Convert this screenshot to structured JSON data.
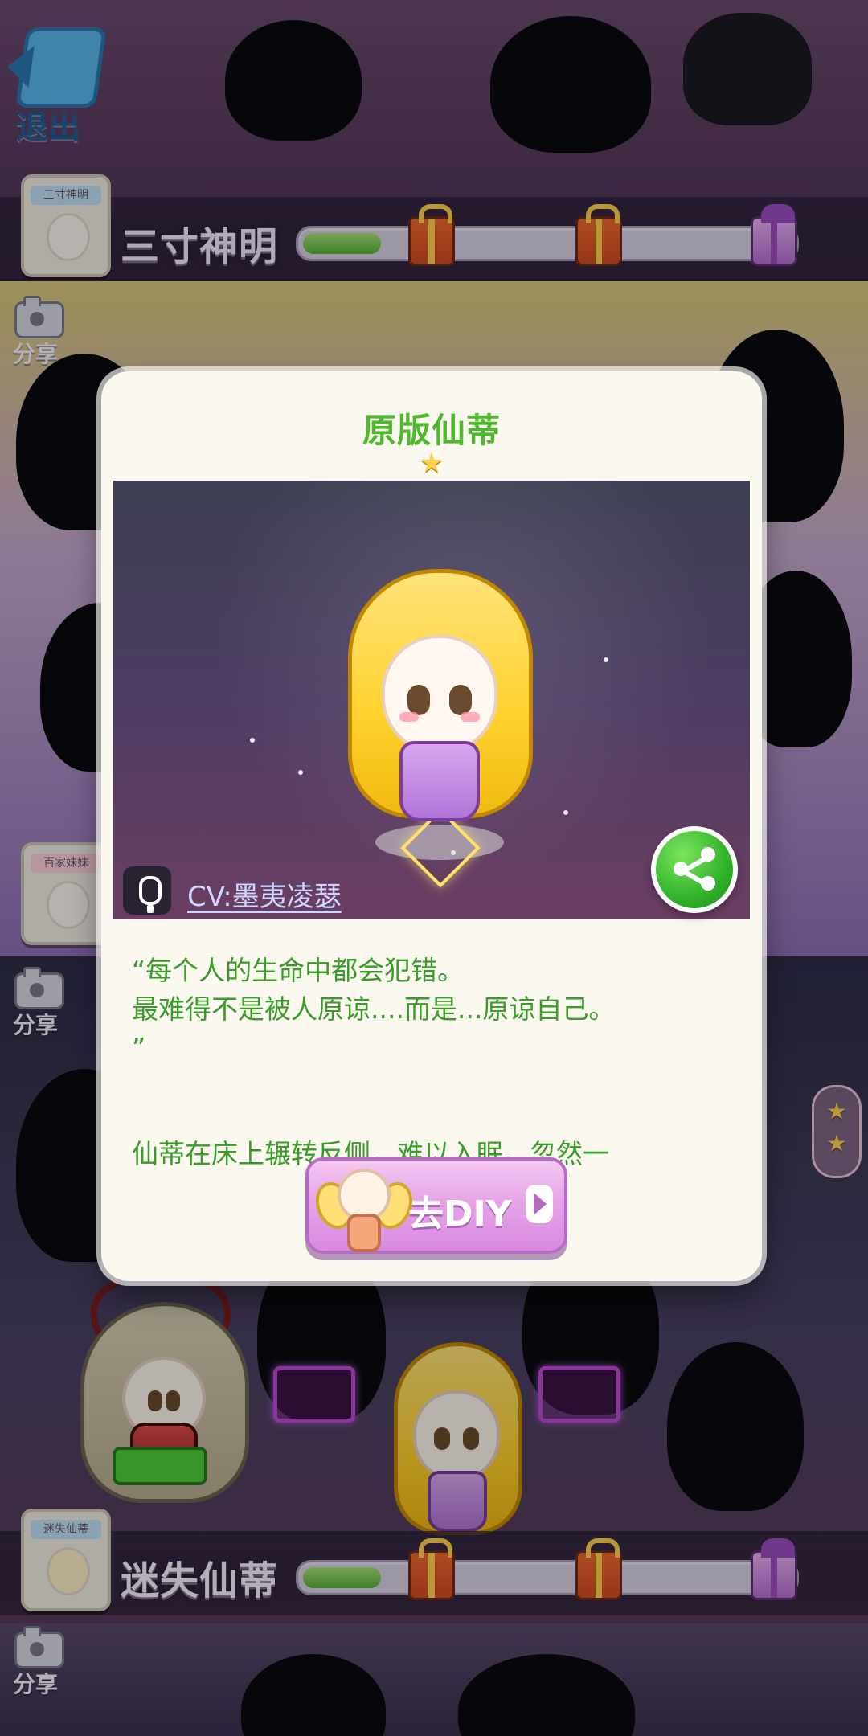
{
  "top": {
    "exit_label": "退出",
    "collection_title": "三寸神明",
    "badge_small_text": "三寸神明",
    "progress_fraction": 0.16
  },
  "bottom": {
    "collection_title": "迷失仙蒂",
    "badge_small_text": "迷失仙蒂",
    "progress_fraction": 0.16
  },
  "share_label": "分享",
  "side_badge_text": "百家妹妹",
  "modal": {
    "title": "原版仙蒂",
    "cv_text": "CV:墨夷凌瑟",
    "quote_lines": [
      "“每个人的生命中都会犯错。",
      "最难得不是被人原谅....而是...原谅自己。",
      "”"
    ],
    "story_preview": "仙蒂在床上辗转反侧，难以入眠。忽然一",
    "diy_button": "去DIY"
  },
  "icons": {
    "exit": "back-arrow-icon",
    "share": "camera-icon",
    "gift_common": "gift-box-icon",
    "gift_rare": "gift-box-icon",
    "mic": "microphone-icon",
    "share_circle": "share-icon",
    "star": "star-icon"
  },
  "colors": {
    "modal_bg": "#fbf8ef",
    "title_green": "#4fb82e",
    "text_green": "#3a9a2a",
    "diy_pink": "#e6a5e8",
    "progress_green": "#5bb33a"
  }
}
